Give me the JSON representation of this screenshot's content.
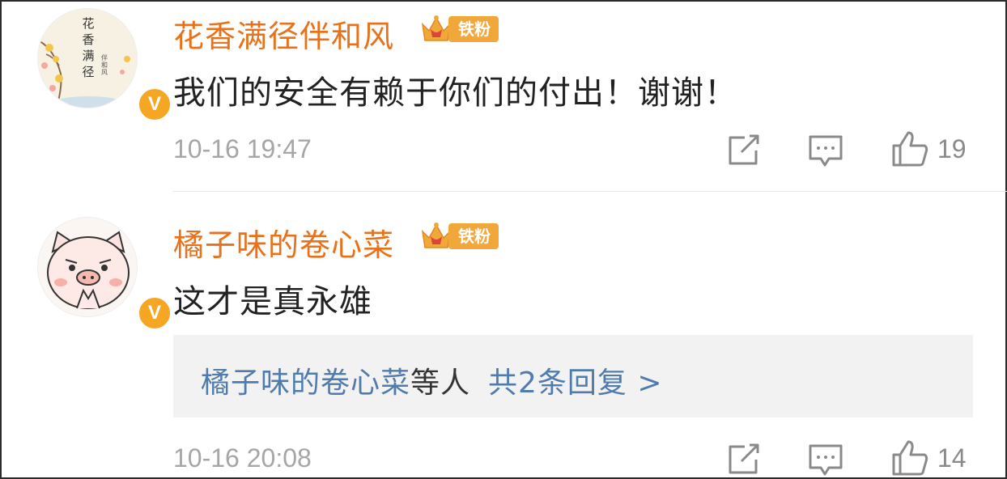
{
  "comments": [
    {
      "username": "花香满径伴和风",
      "fan_badge": "铁粉",
      "verified_mark": "V",
      "text": "我们的安全有赖于你们的付出！谢谢！",
      "time": "10-16 19:47",
      "likes": "19",
      "avatar_text": [
        "花",
        "香",
        "满",
        "径"
      ],
      "avatar_subtext": "伴和风"
    },
    {
      "username": "橘子味的卷心菜",
      "fan_badge": "铁粉",
      "verified_mark": "V",
      "text": "这才是真永雄",
      "time": "10-16 20:08",
      "likes": "14",
      "reply_summary": {
        "names": "橘子味的卷心菜",
        "suffix": "等人",
        "count": "共2条回复 >"
      }
    }
  ],
  "icons": {
    "share": "share-icon",
    "comment": "comment-icon",
    "like": "thumbs-up-icon",
    "crown": "crown-icon",
    "verified": "verified-icon"
  },
  "colors": {
    "username": "#e8711a",
    "badge": "#f2a73a",
    "verified": "#f5a623",
    "link": "#4f7cad",
    "meta": "#a6a6a6"
  }
}
